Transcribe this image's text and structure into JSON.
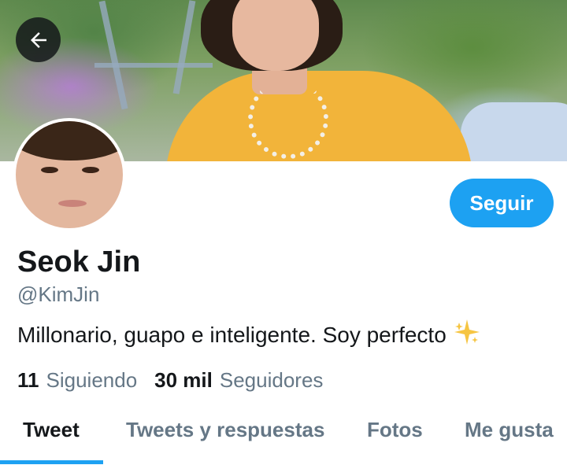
{
  "profile": {
    "follow_label": "Seguir",
    "name": "Seok Jin",
    "handle": "@KimJin",
    "bio": "Millonario, guapo e inteligente. Soy perfecto",
    "bio_emoji": "sparkle-icon"
  },
  "stats": {
    "following_count": "11",
    "following_label": "Siguiendo",
    "followers_count": "30 mil",
    "followers_label": "Seguidores"
  },
  "tabs": [
    {
      "label": "Tweet",
      "active": true
    },
    {
      "label": "Tweets y respuestas",
      "active": false
    },
    {
      "label": "Fotos",
      "active": false
    },
    {
      "label": "Me gusta",
      "active": false
    }
  ],
  "colors": {
    "accent": "#1da1f2",
    "text_primary": "#14171a",
    "text_secondary": "#657786"
  }
}
